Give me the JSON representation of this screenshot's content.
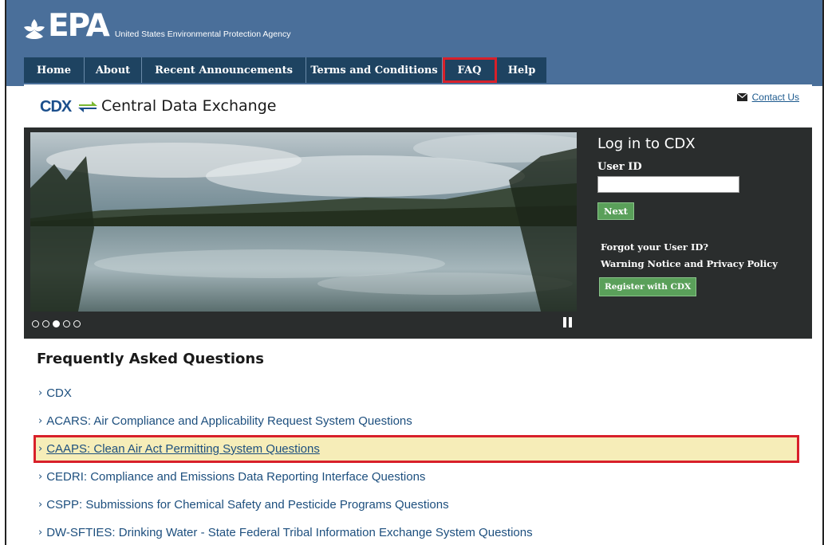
{
  "header": {
    "logo_text": "EPA",
    "agency_name": "United States Environmental Protection Agency"
  },
  "nav": {
    "tabs": [
      {
        "label": "Home",
        "name": "nav-tab-home"
      },
      {
        "label": "About",
        "name": "nav-tab-about"
      },
      {
        "label": "Recent Announcements",
        "name": "nav-tab-recent-announcements"
      },
      {
        "label": "Terms and Conditions",
        "name": "nav-tab-terms-and-conditions"
      },
      {
        "label": "FAQ",
        "name": "nav-tab-faq",
        "highlighted": true
      },
      {
        "label": "Help",
        "name": "nav-tab-help"
      }
    ]
  },
  "titlebar": {
    "cdx_logo": "CDX",
    "site_name": "Central Data Exchange",
    "contact_label": "Contact Us",
    "contact_icon": "envelope-icon"
  },
  "hero": {
    "slide_count": 5,
    "active_slide": 3,
    "pause_icon": "pause-icon"
  },
  "login": {
    "title": "Log in to CDX",
    "userid_label": "User ID",
    "userid_value": "",
    "next_label": "Next",
    "forgot_label": "Forgot your User ID?",
    "warning_label": "Warning Notice and Privacy Policy",
    "register_label": "Register with CDX"
  },
  "faq": {
    "heading": "Frequently Asked Questions",
    "items": [
      {
        "label": "CDX"
      },
      {
        "label": "ACARS: Air Compliance and Applicability Request System Questions"
      },
      {
        "label": "CAAPS: Clean Air Act Permitting System Questions",
        "highlighted": true
      },
      {
        "label": "CEDRI: Compliance and Emissions Data Reporting Interface Questions"
      },
      {
        "label": "CSPP: Submissions for Chemical Safety and Pesticide Programs Questions"
      },
      {
        "label": "DW-SFTIES: Drinking Water - State Federal Tribal Information Exchange System Questions"
      }
    ]
  },
  "colors": {
    "header_bg": "#4a6f9a",
    "nav_bg": "#1e4361",
    "highlight_border": "#d8202a",
    "highlight_fill": "#f6edb8",
    "button_green": "#5aa05a",
    "link_blue": "#1d4f7e"
  }
}
